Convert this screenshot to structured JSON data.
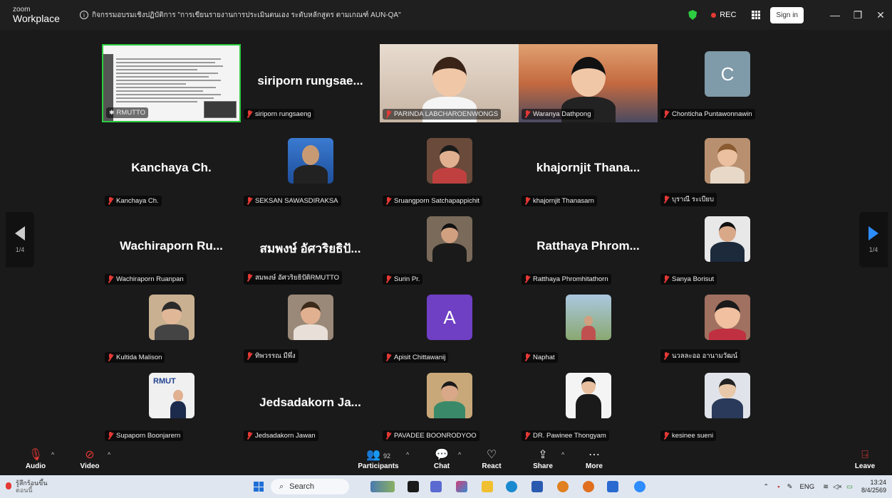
{
  "window": {
    "brand_small": "zoom",
    "brand_large": "Workplace",
    "meeting_title": "กิจกรรมอบรมเชิงปฏิบัติการ \"การเขียนรายงานการประเมินตนเอง ระดับหลักสูตร ตามเกณฑ์ AUN-QA\"",
    "rec_label": "REC",
    "sign_in_label": "Sign in"
  },
  "navigation": {
    "left_page": "1/4",
    "right_page": "1/4"
  },
  "tiles": [
    {
      "name": "RMUTTO",
      "type": "screen-share",
      "display_name": ""
    },
    {
      "name": "siriporn rungsaeng",
      "type": "name-only",
      "display_name": "siriporn rungsae..."
    },
    {
      "name": "PARINDA LABCHAROENWONGS",
      "type": "avatar-3d",
      "display_name": ""
    },
    {
      "name": "Waranya Dathpong",
      "type": "avatar-3d",
      "display_name": ""
    },
    {
      "name": "Chonticha Puntawonnawin",
      "type": "letter",
      "letter": "C",
      "display_name": ""
    },
    {
      "name": "Kanchaya Ch.",
      "type": "name-only",
      "display_name": "Kanchaya Ch."
    },
    {
      "name": "SEKSAN SAWASDIRAKSA",
      "type": "photo",
      "display_name": ""
    },
    {
      "name": "Sruangporn Satchapappichit",
      "type": "photo",
      "display_name": ""
    },
    {
      "name": "khajornjit Thanasarn",
      "type": "name-only",
      "display_name": "khajornjit Thana..."
    },
    {
      "name": "บุราณี ระเบียบ",
      "type": "photo",
      "display_name": ""
    },
    {
      "name": "Wachiraporn Ruanpan",
      "type": "name-only",
      "display_name": "Wachiraporn Ru..."
    },
    {
      "name": "สมพงษ์ อัศวริยธิปัติRMUTTO",
      "type": "name-only",
      "display_name": "สมพงษ์ อัศวริยธิปั..."
    },
    {
      "name": "Surin Pr.",
      "type": "photo",
      "display_name": ""
    },
    {
      "name": "Ratthaya Phromhitathorn",
      "type": "name-only",
      "display_name": "Ratthaya Phrom..."
    },
    {
      "name": "Sanya Borisut",
      "type": "photo",
      "display_name": ""
    },
    {
      "name": "Kultida Malison",
      "type": "photo",
      "display_name": ""
    },
    {
      "name": "ทิพวรรณ มีพึ่ง",
      "type": "photo",
      "display_name": ""
    },
    {
      "name": "Apisit Chittawanij",
      "type": "letter",
      "letter": "A",
      "display_name": ""
    },
    {
      "name": "Naphat",
      "type": "photo",
      "display_name": ""
    },
    {
      "name": "นวลละออ อานามวัฒน์",
      "type": "photo",
      "display_name": ""
    },
    {
      "name": "Supaporn Boonjarern",
      "type": "photo",
      "display_name": ""
    },
    {
      "name": "Jedsadakorn Jawan",
      "type": "name-only",
      "display_name": "Jedsadakorn Ja..."
    },
    {
      "name": "PAVADEE BOONRODYOO",
      "type": "photo",
      "display_name": ""
    },
    {
      "name": "DR. Pawinee Thongyam",
      "type": "photo",
      "display_name": ""
    },
    {
      "name": "kesinee sueni",
      "type": "photo",
      "display_name": ""
    }
  ],
  "toolbar": {
    "audio": "Audio",
    "video": "Video",
    "participants": "Participants",
    "participants_count": "92",
    "chat": "Chat",
    "react": "React",
    "share": "Share",
    "more": "More",
    "leave": "Leave"
  },
  "taskbar": {
    "weather_line1": "รู้สึกร้อนขึ้น",
    "weather_line2": "ตอนนี้",
    "search_label": "Search",
    "lang": "ENG",
    "time": "13:24",
    "date": "8/4/2569"
  },
  "colors": {
    "rec_dot": "#e53935",
    "security_shield": "#2ecc40",
    "nav_next": "#2d8cff",
    "letter_C": "#7f9aa8",
    "letter_A": "#6f3fc4",
    "active_speaker_border": "#2ecc40"
  }
}
